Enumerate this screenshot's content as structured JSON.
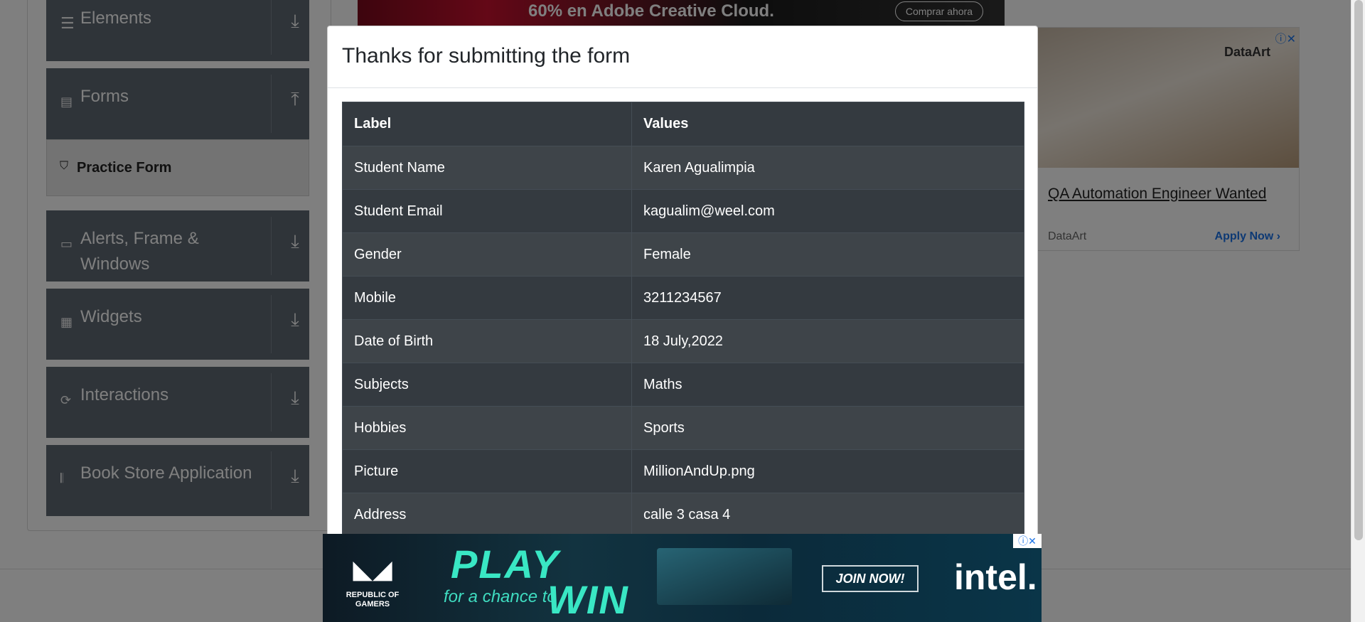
{
  "sidebar": {
    "groups": [
      {
        "label": "Elements",
        "icon": "hamburger-icon",
        "arrow": "download-icon"
      },
      {
        "label": "Forms",
        "icon": "form-icon",
        "arrow": "upload-icon"
      },
      {
        "label": "Alerts, Frame & Windows",
        "icon": "window-icon",
        "arrow": "download-icon"
      },
      {
        "label": "Widgets",
        "icon": "widgets-icon",
        "arrow": "download-icon"
      },
      {
        "label": "Interactions",
        "icon": "interactions-icon",
        "arrow": "download-icon"
      },
      {
        "label": "Book Store Application",
        "icon": "books-icon",
        "arrow": "download-icon"
      }
    ],
    "active_item": {
      "label": "Practice Form",
      "icon": "html5-icon"
    }
  },
  "top_banner": {
    "text": "60% en Adobe Creative Cloud.",
    "button": "Comprar ahora"
  },
  "side_ad": {
    "logo": "DataArt",
    "title": "QA Automation Engineer Wanted",
    "brand": "DataArt",
    "cta": "Apply Now"
  },
  "modal": {
    "title": "Thanks for submitting the form",
    "table": {
      "headers": [
        "Label",
        "Values"
      ],
      "rows": [
        [
          "Student Name",
          "Karen Agualimpia"
        ],
        [
          "Student Email",
          "kagualim@weel.com"
        ],
        [
          "Gender",
          "Female"
        ],
        [
          "Mobile",
          "3211234567"
        ],
        [
          "Date of Birth",
          "18 July,2022"
        ],
        [
          "Subjects",
          "Maths"
        ],
        [
          "Hobbies",
          "Sports"
        ],
        [
          "Picture",
          "MillionAndUp.png"
        ],
        [
          "Address",
          "calle 3 casa 4"
        ]
      ]
    }
  },
  "bottom_ad": {
    "rog": "REPUBLIC OF GAMERS",
    "play": "PLAY",
    "chance": "for a chance to",
    "win": "WIN",
    "join": "JOIN NOW!",
    "intel": "intel."
  }
}
